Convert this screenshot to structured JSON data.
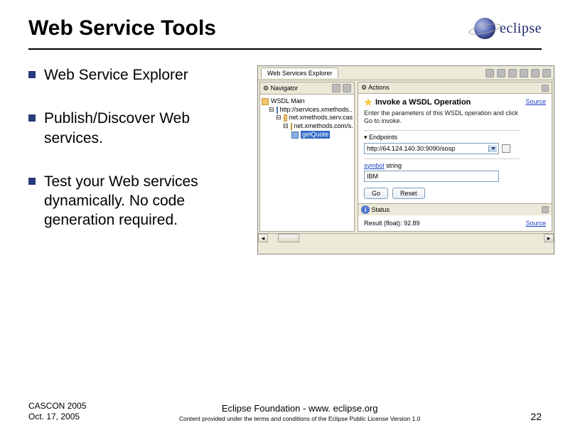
{
  "header": {
    "title": "Web Service Tools",
    "logo_text": "eclipse"
  },
  "bullets": [
    "Web Service Explorer",
    "Publish/Discover Web services.",
    "Test your Web services dynamically. No code generation required."
  ],
  "screenshot": {
    "tab": "Web Services Explorer",
    "navigator": {
      "title": "Navigator",
      "tree": {
        "root": "WSDL Main",
        "n1": "http://services.xmethods...",
        "n2": "net.xmethods.serv.cas",
        "n3": "net.xmethods.com/s...",
        "n4": "getQuote"
      }
    },
    "actions": {
      "title": "Actions",
      "heading": "Invoke a WSDL Operation",
      "source": "Source",
      "desc": "Enter the parameters of this WSDL operation and click Go to invoke.",
      "endpoints_label": "Endpoints",
      "endpoint_value": "http://64.124.140.30:9090/sosp",
      "symbol_label": "symbol",
      "symbol_type": "string",
      "symbol_value": "IBM",
      "go": "Go",
      "reset": "Reset"
    },
    "status": {
      "title": "Status",
      "result": "Result (float): 92.89",
      "source": "Source"
    }
  },
  "footer": {
    "left1": "CASCON 2005",
    "left2": "Oct. 17, 2005",
    "center1": "Eclipse Foundation - www. eclipse.org",
    "center2": "Content provided under the terms and conditions of the Eclipse Public License Version 1.0",
    "page": "22"
  }
}
